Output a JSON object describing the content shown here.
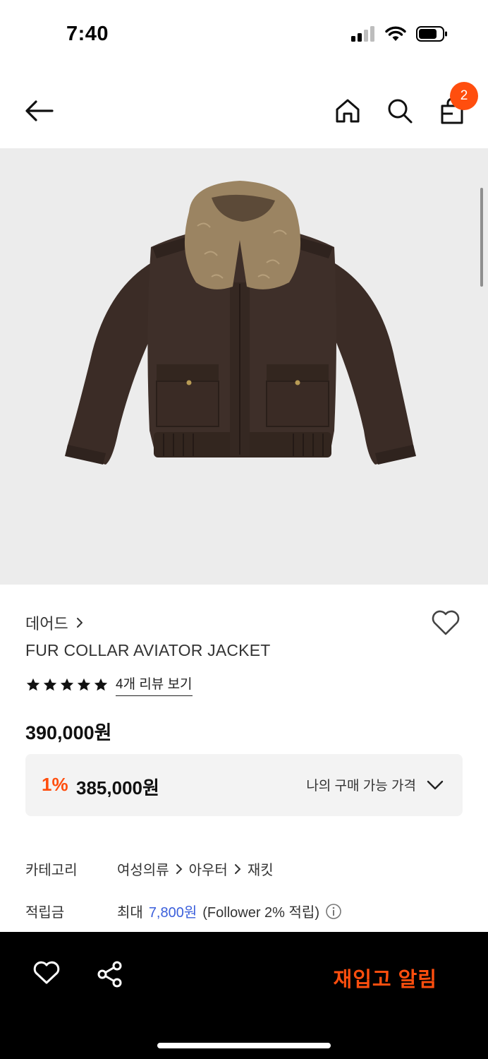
{
  "status_bar": {
    "time": "7:40"
  },
  "header": {
    "back_icon": "arrow-left-icon",
    "home_icon": "home-icon",
    "search_icon": "search-icon",
    "bag_icon": "shopping-bag-icon",
    "cart_count": "2"
  },
  "product": {
    "brand": "데어드",
    "name": "FUR COLLAR AVIATOR JACKET",
    "rating_stars": 5,
    "review_link": "4개 리뷰 보기",
    "price": "390,000원",
    "benefit": {
      "discount_rate": "1%",
      "discount_price": "385,000원",
      "my_price_label": "나의 구매 가능 가격"
    },
    "category": {
      "label": "카테고리",
      "path": [
        "여성의류",
        "아우터",
        "재킷"
      ]
    },
    "points": {
      "label": "적립금",
      "prefix": "최대",
      "amount": "7,800원",
      "suffix": "(Follower 2% 적립)"
    }
  },
  "bottom_bar": {
    "restock_label": "재입고 알림",
    "wish_icon": "heart-icon",
    "share_icon": "share-icon"
  },
  "colors": {
    "accent": "#ff4e0e",
    "link_blue": "#3b5fdb",
    "image_bg": "#ececec",
    "jacket": "#3b2c26",
    "fur": "#9b8462"
  }
}
